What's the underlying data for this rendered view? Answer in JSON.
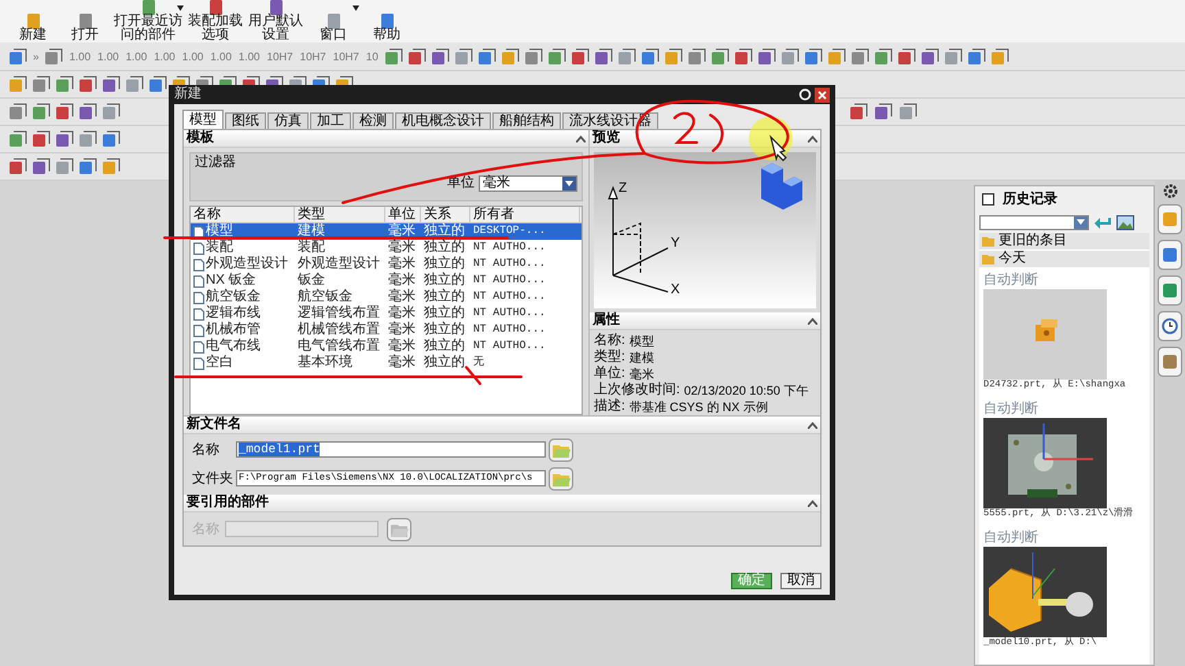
{
  "ribbon": [
    {
      "label": "新建",
      "menu": false
    },
    {
      "label": "打开",
      "menu": false
    },
    {
      "label": "打开最近访问的部件",
      "menu": true
    },
    {
      "label": "装配加载选项",
      "menu": false
    },
    {
      "label": "用户默认设置",
      "menu": false
    },
    {
      "label": "窗口",
      "menu": true
    },
    {
      "label": "帮助",
      "menu": false
    }
  ],
  "toolbar_labels": [
    "»",
    "1.00",
    "1.00",
    "1.00",
    "1.00",
    "1.00",
    "1.00",
    "1.00",
    "10H7",
    "10H7",
    "10H7",
    "10"
  ],
  "dialog": {
    "title": "新建",
    "tabs": [
      {
        "label": "模型",
        "selected": true
      },
      {
        "label": "图纸",
        "selected": false
      },
      {
        "label": "仿真",
        "selected": false
      },
      {
        "label": "加工",
        "selected": false
      },
      {
        "label": "检测",
        "selected": false
      },
      {
        "label": "机电概念设计",
        "selected": false
      },
      {
        "label": "船舶结构",
        "selected": false
      },
      {
        "label": "流水线设计器",
        "selected": false
      }
    ],
    "template": {
      "title": "模板",
      "filter_title": "过滤器",
      "unit_label": "单位",
      "unit_value": "毫米",
      "columns": [
        "名称",
        "类型",
        "单位",
        "关系",
        "所有者"
      ],
      "rows": [
        {
          "cells": [
            "模型",
            "建模",
            "毫米",
            "独立的",
            "DESKTOP-..."
          ],
          "selected": true
        },
        {
          "cells": [
            "装配",
            "装配",
            "毫米",
            "独立的",
            "NT AUTHO..."
          ],
          "selected": false
        },
        {
          "cells": [
            "外观造型设计",
            "外观造型设计",
            "毫米",
            "独立的",
            "NT AUTHO..."
          ],
          "selected": false
        },
        {
          "cells": [
            "NX 钣金",
            "钣金",
            "毫米",
            "独立的",
            "NT AUTHO..."
          ],
          "selected": false
        },
        {
          "cells": [
            "航空钣金",
            "航空钣金",
            "毫米",
            "独立的",
            "NT AUTHO..."
          ],
          "selected": false
        },
        {
          "cells": [
            "逻辑布线",
            "逻辑管线布置",
            "毫米",
            "独立的",
            "NT AUTHO..."
          ],
          "selected": false
        },
        {
          "cells": [
            "机械布管",
            "机械管线布置",
            "毫米",
            "独立的",
            "NT AUTHO..."
          ],
          "selected": false
        },
        {
          "cells": [
            "电气布线",
            "电气管线布置",
            "毫米",
            "独立的",
            "NT AUTHO..."
          ],
          "selected": false
        },
        {
          "cells": [
            "空白",
            "基本环境",
            "毫米",
            "独立的",
            "无"
          ],
          "selected": false
        }
      ]
    },
    "preview": {
      "title": "预览",
      "axis_labels": [
        "Z",
        "Y",
        "X"
      ]
    },
    "properties": {
      "title": "属性",
      "items": [
        {
          "label": "名称:",
          "value": "模型"
        },
        {
          "label": "类型:",
          "value": "建模"
        },
        {
          "label": "单位:",
          "value": "毫米"
        },
        {
          "label": "上次修改时间:",
          "value": "02/13/2020 10:50 下午"
        },
        {
          "label": "描述:",
          "value": "带基准 CSYS 的 NX 示例"
        }
      ]
    },
    "new_file": {
      "title": "新文件名",
      "name_label": "名称",
      "name_value": "_model1.prt",
      "name_text_selected": true,
      "folder_label": "文件夹",
      "folder_value": "F:\\Program Files\\Siemens\\NX 10.0\\LOCALIZATION\\prc\\s"
    },
    "reference": {
      "title": "要引用的部件",
      "name_label": "名称",
      "disabled": true
    },
    "buttons": [
      "确定",
      "取消"
    ]
  },
  "history": {
    "title": "历史记录",
    "checked": false,
    "groups": [
      "更旧的条目",
      "今天"
    ],
    "entries": [
      {
        "label": "自动判断",
        "caption": "D24732.prt, 从 E:\\shangxa"
      },
      {
        "label": "自动判断",
        "caption": "5555.prt, 从 D:\\3.21\\z\\滑滑"
      },
      {
        "label": "自动判断",
        "caption": "_model10.prt, 从 D:\\"
      }
    ]
  }
}
